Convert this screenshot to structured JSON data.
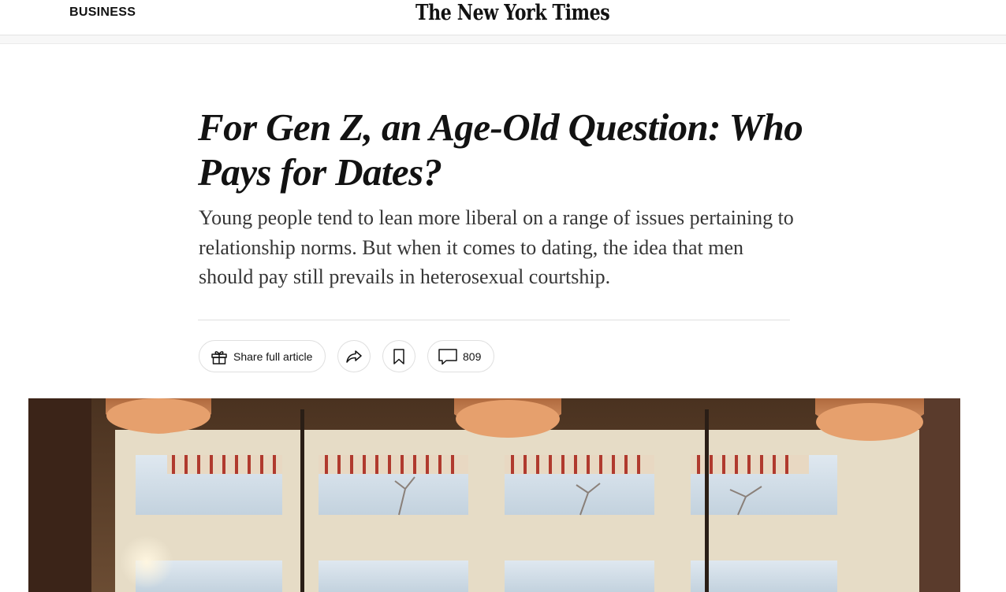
{
  "masthead": {
    "section_label": "BUSINESS",
    "logo_text": "The New York Times"
  },
  "article": {
    "headline": "For Gen Z, an Age-Old Question: Who Pays for Dates?",
    "summary": "Young people tend to lean more liberal on a range of issues pertaining to relationship norms. But when it comes to dating, the idea that men should pay still prevails in heterosexual courtship."
  },
  "actions": {
    "share_label": "Share full article",
    "comment_count": "809",
    "icons": {
      "share": "gift-icon",
      "forward": "share-arrow-icon",
      "save": "bookmark-icon",
      "comments": "comment-bubble-icon"
    }
  },
  "colors": {
    "text": "#121212",
    "summary_text": "#363636",
    "border": "#dfdfdf"
  }
}
